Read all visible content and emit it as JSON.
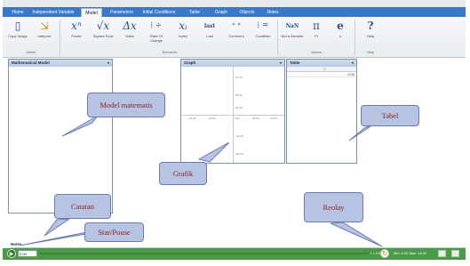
{
  "ribbon": {
    "tabs": [
      {
        "label": "Home"
      },
      {
        "label": "Independent Variable"
      },
      {
        "label": "Model"
      },
      {
        "label": "Parameters"
      },
      {
        "label": "Initial Conditions"
      },
      {
        "label": "Table"
      },
      {
        "label": "Graph"
      },
      {
        "label": "Objects"
      },
      {
        "label": "Notes"
      }
    ],
    "active_tab": "Model",
    "buttons": [
      {
        "icon": "copy-image-icon",
        "glyph": "▯",
        "label": "Copy Image"
      },
      {
        "icon": "interpret-icon",
        "glyph": "⇲",
        "label": "Interpret"
      },
      {
        "icon": "power-icon",
        "glyph": "xⁿ",
        "label": "Power"
      },
      {
        "icon": "square-root-icon",
        "glyph": "√x",
        "label": "Square Root"
      },
      {
        "icon": "delta-icon",
        "glyph": "Δx",
        "label": "Delta"
      },
      {
        "icon": "rate-of-change-icon",
        "glyph": "⁞ ÷",
        "label": "Rate Of Change"
      },
      {
        "icon": "index-icon",
        "glyph": "xᵢ",
        "label": "Index"
      },
      {
        "icon": "last-icon",
        "glyph": "last",
        "label": "Last"
      },
      {
        "icon": "comment-icon",
        "glyph": "\" \"",
        "label": "Comment"
      },
      {
        "icon": "condition-icon",
        "glyph": "⁞ =",
        "label": "Condition"
      },
      {
        "icon": "not-a-number-icon",
        "glyph": "NaN",
        "label": "Not a Number"
      },
      {
        "icon": "pi-icon",
        "glyph": "π",
        "label": "Pi"
      },
      {
        "icon": "e-icon",
        "glyph": "e",
        "label": "e"
      },
      {
        "icon": "help-icon",
        "glyph": "?",
        "label": "Help"
      }
    ],
    "groups": [
      {
        "label": "Model"
      },
      {
        "label": "Elements"
      },
      {
        "label": "Values"
      },
      {
        "label": "Help"
      }
    ]
  },
  "panels": {
    "model": {
      "title": "Mathematical Model"
    },
    "graph": {
      "title": "Graph",
      "x_ticks": [
        "-10.00",
        "-40.00",
        "0.00",
        "40.00",
        "10.00"
      ],
      "y_ticks": [
        "10.00",
        "80.00",
        "40.00",
        "-40.00",
        "-80.00"
      ]
    },
    "table": {
      "title": "Table",
      "first_value": "0.00"
    }
  },
  "notes": {
    "label": "Notes"
  },
  "bottombar": {
    "time_value": "0.00",
    "t_readout": "t = 0.00",
    "minmax": "Min: 0.00 Max: 10.00"
  },
  "callouts": {
    "model": "Model matematis",
    "tabel": "Tabel",
    "grafik": "Grafik",
    "catatan": "Catatan",
    "start_pause": "Star/Pouse",
    "replay": "Reolay"
  },
  "colors": {
    "tab_bar": "#3a78c8",
    "bottom_bar": "#4b9a46",
    "callout_fill": "#b7c3e3",
    "callout_text": "#8a1d1d"
  }
}
